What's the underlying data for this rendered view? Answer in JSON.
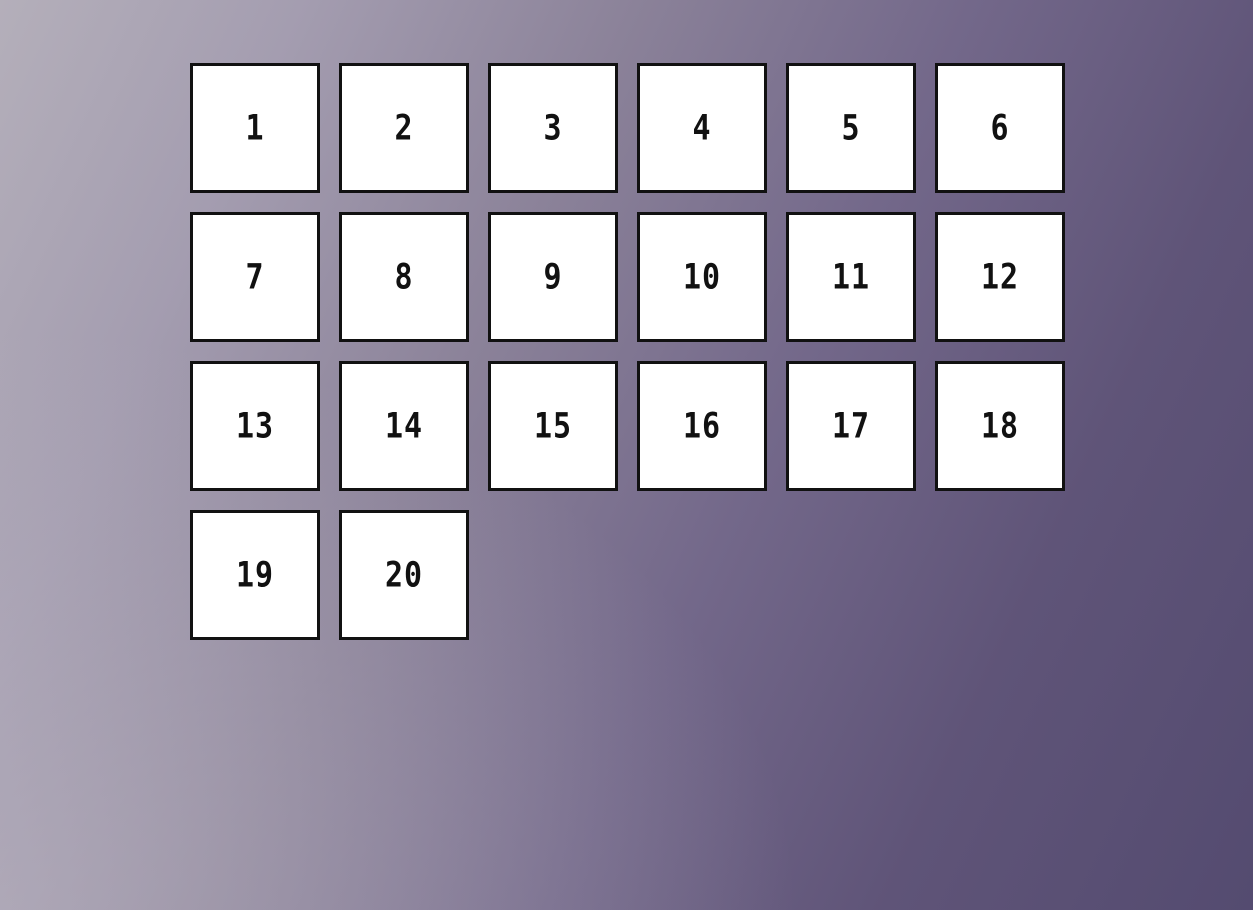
{
  "board": {
    "tiles": [
      {
        "label": "1"
      },
      {
        "label": "2"
      },
      {
        "label": "3"
      },
      {
        "label": "4"
      },
      {
        "label": "5"
      },
      {
        "label": "6"
      },
      {
        "label": "7"
      },
      {
        "label": "8"
      },
      {
        "label": "9"
      },
      {
        "label": "10"
      },
      {
        "label": "11"
      },
      {
        "label": "12"
      },
      {
        "label": "13"
      },
      {
        "label": "14"
      },
      {
        "label": "15"
      },
      {
        "label": "16"
      },
      {
        "label": "17"
      },
      {
        "label": "18"
      },
      {
        "label": "19"
      },
      {
        "label": "20"
      }
    ]
  },
  "colors": {
    "tile_background": "#ffffff",
    "tile_border": "#111111",
    "background_light": "#b4afba",
    "background_dark": "#544b70"
  }
}
